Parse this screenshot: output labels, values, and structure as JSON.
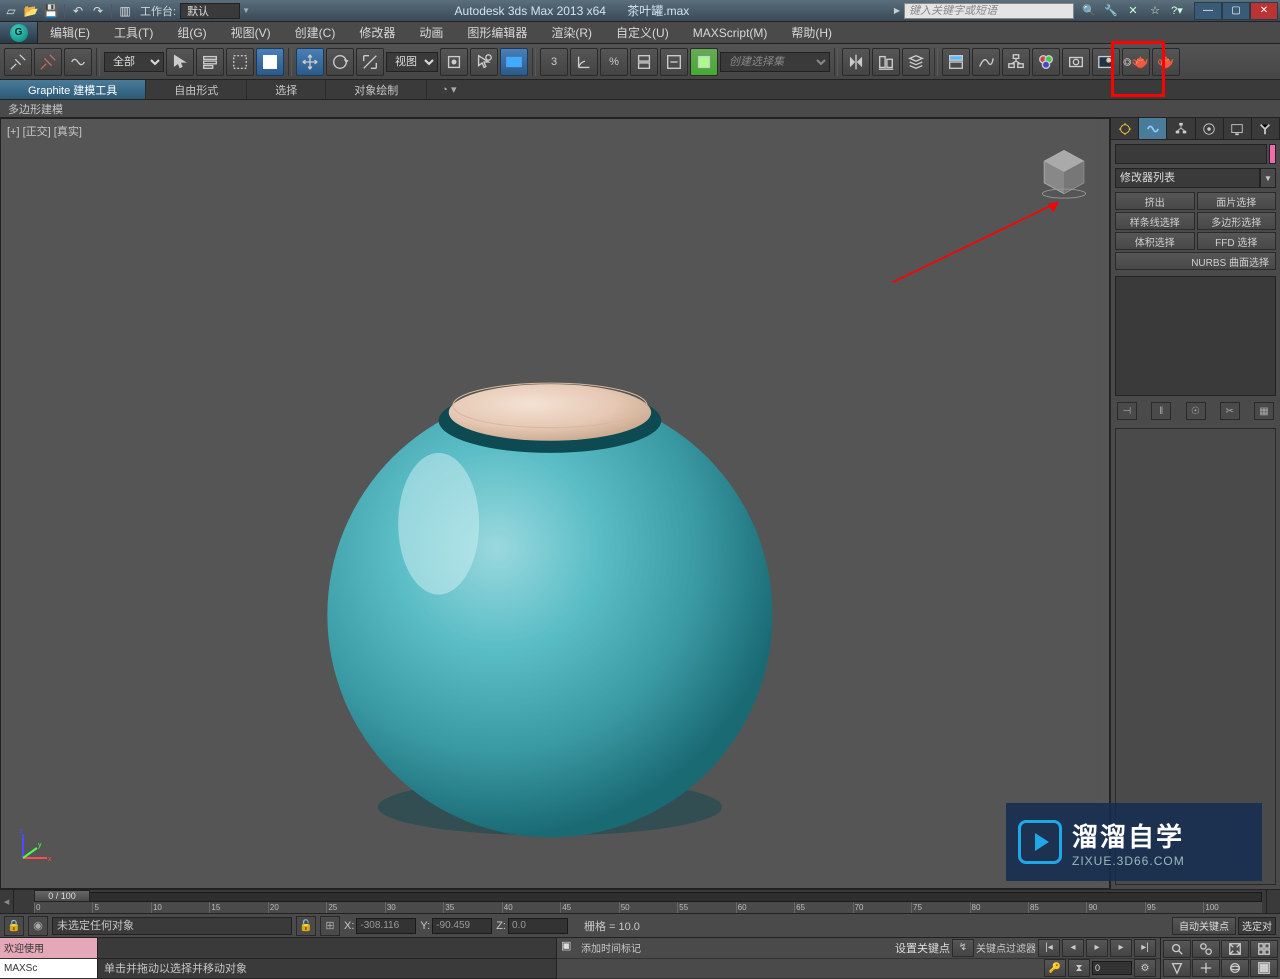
{
  "title_bar": {
    "workspace_label": "工作台:",
    "workspace_value": "默认",
    "product": "Autodesk 3ds Max  2013 x64",
    "filename": "茶叶罐.max",
    "search_placeholder": "键入关键字或短语"
  },
  "menus": [
    "编辑(E)",
    "工具(T)",
    "组(G)",
    "视图(V)",
    "创建(C)",
    "修改器",
    "动画",
    "图形编辑器",
    "渲染(R)",
    "自定义(U)",
    "MAXScript(M)",
    "帮助(H)"
  ],
  "toolbar": {
    "filter_all": "全部",
    "ref_coord": "视图",
    "selection_set": "创建选择集"
  },
  "ribbon": {
    "tabs": [
      "Graphite 建模工具",
      "自由形式",
      "选择",
      "对象绘制"
    ],
    "sub": "多边形建模"
  },
  "viewport": {
    "label": "[+] [正交] [真实]"
  },
  "cmd_panel": {
    "modifier_list": "修改器列表",
    "buttons": [
      "挤出",
      "面片选择",
      "样条线选择",
      "多边形选择",
      "体积选择",
      "FFD 选择"
    ],
    "nurbs_btn": "NURBS 曲面选择"
  },
  "timeline": {
    "handle": "0 / 100",
    "ticks": [
      "0",
      "5",
      "10",
      "15",
      "20",
      "25",
      "30",
      "35",
      "40",
      "45",
      "50",
      "55",
      "60",
      "65",
      "70",
      "75",
      "80",
      "85",
      "90",
      "95",
      "100"
    ]
  },
  "coord_bar": {
    "sel_info": "未选定任何对象",
    "x": "-308.116",
    "y": "-90.459",
    "z": "0.0",
    "grid": "栅格 = 10.0",
    "auto_key": "自动关键点",
    "set_key": "设置关键点",
    "sel_mode": "选定对"
  },
  "bottom": {
    "script1": "欢迎使用",
    "script2": "MAXSc",
    "prompt1": "单击并拖动以选择并移动对象",
    "add_time_tag": "添加时间标记",
    "key_filter": "关键点过滤器"
  },
  "watermark": {
    "cn": "溜溜自学",
    "en": "ZIXUE.3D66.COM"
  }
}
